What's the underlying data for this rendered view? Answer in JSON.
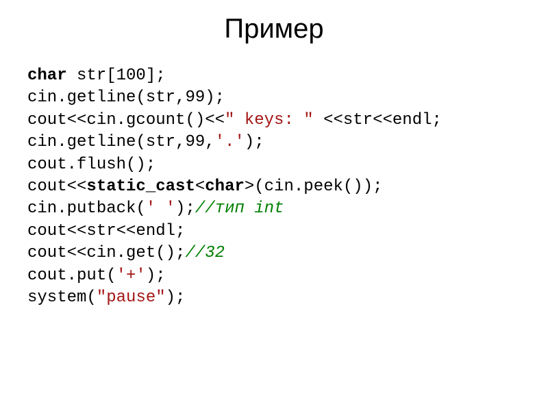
{
  "title": "Пример",
  "code": {
    "l1_kw": "char",
    "l1_rest": " str[100];",
    "l2": "cin.getline(str,99);",
    "l3_a": "cout<<cin.gcount()<<",
    "l3_str": "\" keys: \"",
    "l3_b": " <<str<<endl;",
    "l4_a": "cin.getline(str,99,",
    "l4_str": "'.'",
    "l4_b": ");",
    "l5": "cout.flush();",
    "l6_a": "cout<<",
    "l6_kw1": "static_cast",
    "l6_b": "<",
    "l6_kw2": "char",
    "l6_c": ">(cin.peek());",
    "l7_a": "cin.putback(",
    "l7_str": "' '",
    "l7_b": ");",
    "l7_com": "//тип int",
    "l8": "cout<<str<<endl;",
    "l9_a": "cout<<cin.get();",
    "l9_com": "//32",
    "l10_a": "cout.put(",
    "l10_str": "'+'",
    "l10_b": ");",
    "l11_a": "system(",
    "l11_str": "\"pause\"",
    "l11_b": ");"
  }
}
